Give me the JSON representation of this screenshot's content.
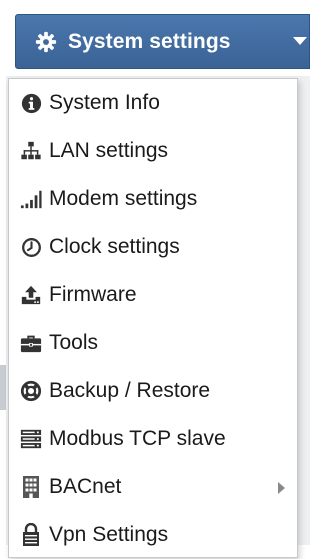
{
  "menu_button": {
    "label": "System settings",
    "icon": "gear-icon",
    "color": "#4672a8"
  },
  "menu": {
    "items": [
      {
        "label": "System Info",
        "icon": "info-circle-icon"
      },
      {
        "label": "LAN settings",
        "icon": "network-icon"
      },
      {
        "label": "Modem settings",
        "icon": "signal-bars-icon"
      },
      {
        "label": "Clock settings",
        "icon": "clock-icon"
      },
      {
        "label": "Firmware",
        "icon": "upload-icon"
      },
      {
        "label": "Tools",
        "icon": "toolbox-icon"
      },
      {
        "label": "Backup / Restore",
        "icon": "lifebuoy-icon"
      },
      {
        "label": "Modbus TCP slave",
        "icon": "server-icon"
      },
      {
        "label": "BACnet",
        "icon": "building-icon",
        "has_submenu": true
      },
      {
        "label": "Vpn Settings",
        "icon": "vpn-icon"
      }
    ]
  }
}
